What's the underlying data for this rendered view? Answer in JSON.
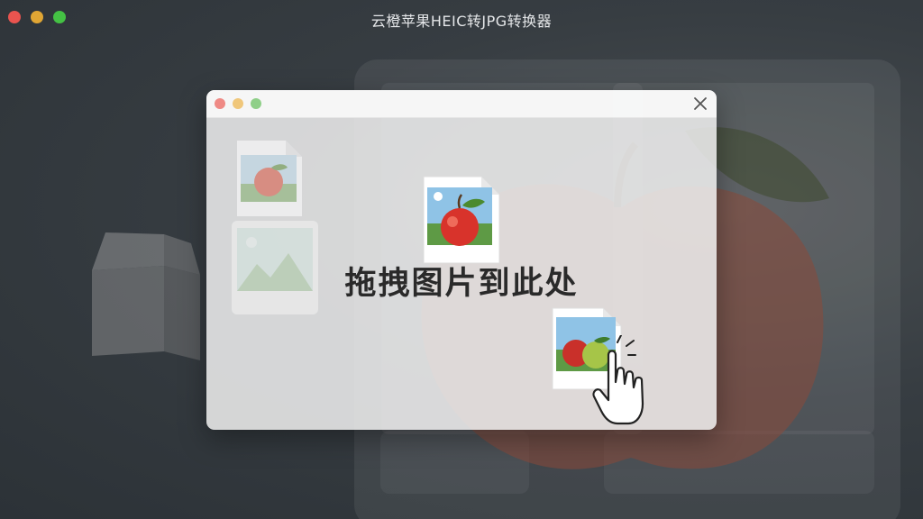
{
  "window": {
    "title": "云橙苹果HEIC转JPG转换器",
    "traffic_lights": [
      "close",
      "minimize",
      "zoom"
    ]
  },
  "drop_dialog": {
    "prompt": "拖拽图片到此处",
    "close_icon": "close-icon",
    "traffic_lights": [
      "close",
      "minimize",
      "zoom"
    ]
  },
  "icons": {
    "files": [
      "apple-image-file-icon",
      "placeholder-image-icon",
      "apple-image-file-icon",
      "apples-image-file-icon"
    ],
    "cursor": "hand-pointer-icon",
    "background": "open-box-icon"
  },
  "colors": {
    "tl_red": "#e9544f",
    "tl_yellow": "#e0a634",
    "tl_green": "#44c144"
  }
}
